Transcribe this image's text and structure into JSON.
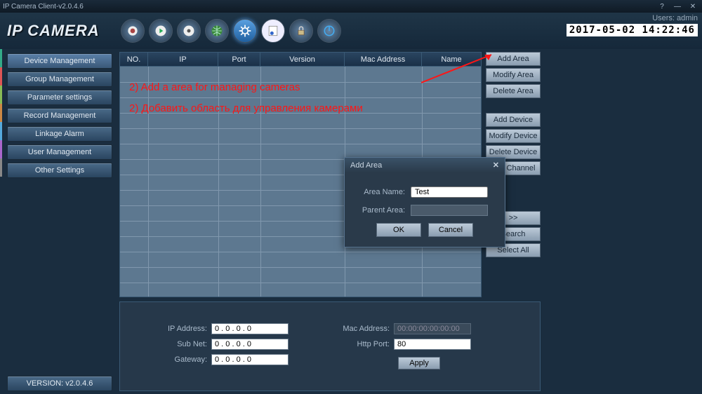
{
  "titlebar": {
    "title": "IP Camera Client-v2.0.4.6"
  },
  "logo": "IP CAMERA",
  "users_label": "Users: admin",
  "datetime": "2017-05-02 14:22:46",
  "sidebar": {
    "items": [
      "Device Management",
      "Group Management",
      "Parameter settings",
      "Record Management",
      "Linkage Alarm",
      "User Management",
      "Other Settings"
    ],
    "version": "VERSION: v2.0.4.6"
  },
  "grid": {
    "headers": [
      "NO.",
      "IP",
      "Port",
      "Version",
      "Mac Address",
      "Name"
    ]
  },
  "right_buttons": {
    "add_area": "Add Area",
    "modify_area": "Modify Area",
    "delete_area": "Delete Area",
    "add_device": "Add Device",
    "modify_device": "Modify Device",
    "delete_device": "Delete Device",
    "edit_channel": "Edit Channel",
    "fwd": ">>",
    "search": "Search",
    "select_all": "Select All"
  },
  "bottom": {
    "ip_label": "IP Address:",
    "ip": "0 . 0 . 0 . 0",
    "subnet_label": "Sub Net:",
    "subnet": "0 . 0 . 0 . 0",
    "gateway_label": "Gateway:",
    "gateway": "0 . 0 . 0 . 0",
    "mac_label": "Mac Address:",
    "mac": "00:00:00:00:00:00",
    "http_label": "Http Port:",
    "http": "80",
    "apply": "Apply"
  },
  "dialog": {
    "title": "Add Area",
    "area_name_label": "Area Name:",
    "area_name": "Test",
    "parent_label": "Parent Area:",
    "parent": "",
    "ok": "OK",
    "cancel": "Cancel"
  },
  "annotations": {
    "en": "2) Add a area for managing cameras",
    "ru": "2) Добавить область для управления камерами"
  }
}
